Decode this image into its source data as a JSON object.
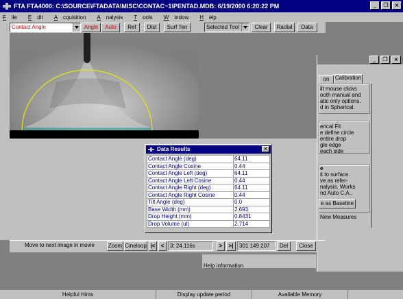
{
  "window": {
    "title": "FTA FTA4000: C:\\SOURCE\\FTADATA\\MISC\\CONTAC~1\\PENTAD.MDB: 6/19/2000 6:20:22 PM",
    "min_glyph": "_",
    "restore_glyph": "❐",
    "close_glyph": "×"
  },
  "menu": [
    {
      "u": "F",
      "rest": "ile"
    },
    {
      "u": "E",
      "rest": "dit"
    },
    {
      "u": "A",
      "rest": "cquisition"
    },
    {
      "u": "A",
      "rest": "nalysis"
    },
    {
      "u": "T",
      "rest": "ools"
    },
    {
      "u": "W",
      "rest": "indow"
    },
    {
      "u": "H",
      "rest": "elp"
    }
  ],
  "toolbar": {
    "mode_value": "Contact Angle",
    "angle_label": "Angle",
    "auto_label": "Auto",
    "ref_label": "Ref",
    "dist_label": "Dist",
    "surften_label": "Surf Ten",
    "tool_value": "Selected Tool",
    "clear_label": "Clear",
    "radial_label": "Radial",
    "data_label": "Data"
  },
  "movie": {
    "hint": "Move to next image in movie",
    "zoom_label": "Zoom",
    "cineloop_label": "Cineloop",
    "first_label": "|<",
    "prev_label": "<",
    "time_value": "3: 24.116s",
    "next_label": ">",
    "last_label": ">|",
    "readout": "301  149  207",
    "del_label": "Del",
    "close_label": "Close"
  },
  "help": {
    "text": "Help information"
  },
  "calibration": {
    "tab_prev": "on",
    "tab_active": "Calibration",
    "group1": [
      "ilt mouse clicks",
      "ooth manual and",
      "atic only options.",
      "d in Spherical."
    ],
    "group2": [
      "erical Fit",
      "e define circle",
      "entire drop",
      "gle edge",
      "each side"
    ],
    "group3_heading": "e",
    "group3": [
      "it to surface.",
      "ve as refer-",
      "nalysis. Works",
      "nd Auto C.A.."
    ],
    "baseline_label": "e as Baseline",
    "new_measures_label": "New Measures"
  },
  "results": {
    "title": "Data Results",
    "rows": [
      {
        "label": "Contact Angle (deg)",
        "value": "64.11"
      },
      {
        "label": "Contact Angle Cosine",
        "value": "0.44"
      },
      {
        "label": "Contact Angle Left (deg)",
        "value": "64.11"
      },
      {
        "label": "Contact Angle Left Cosine",
        "value": "0.44"
      },
      {
        "label": "Contact Angle Right (deg)",
        "value": "64.11"
      },
      {
        "label": "Contact Angle Right Cosine",
        "value": "0.44"
      },
      {
        "label": "Tilt Angle (deg)",
        "value": "0.0"
      },
      {
        "label": "Base Width (mm)",
        "value": "2.693"
      },
      {
        "label": "Drop Height (mm)",
        "value": "0.8431"
      },
      {
        "label": "Drop Volume (ul)",
        "value": "2.714"
      }
    ]
  },
  "status": {
    "hints": "Helpful Hints",
    "update": "Display update period",
    "memory": "Available Memory"
  },
  "colors": {
    "accent_red": "#d00000",
    "title_blue": "#000080",
    "fit_yellow": "#e8e800",
    "baseline_cyan": "#00c0c0"
  }
}
